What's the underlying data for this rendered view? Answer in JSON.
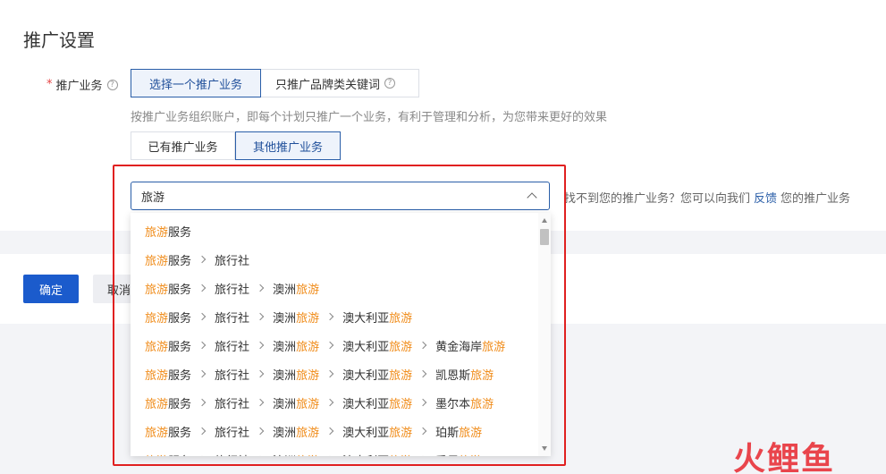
{
  "page": {
    "title": "推广设置"
  },
  "field": {
    "required_mark": "*",
    "label": "推广业务",
    "help": "?"
  },
  "mode_tabs": [
    {
      "label": "选择一个推广业务",
      "active": true
    },
    {
      "label": "只推广品牌类关键词",
      "active": false,
      "help": "?"
    }
  ],
  "hint": "按推广业务组织账户，即每个计划只推广一个业务，有利于管理和分析，为您带来更好的效果",
  "source_tabs": [
    {
      "label": "已有推广业务",
      "active": false
    },
    {
      "label": "其他推广业务",
      "active": true
    }
  ],
  "search": {
    "value": "旅游"
  },
  "not_found": {
    "prefix": "找不到您的推广业务？您可以向我们",
    "link": "反馈",
    "suffix": "您的推广业务"
  },
  "dropdown": {
    "highlight": "旅游",
    "items": [
      [
        "旅游服务"
      ],
      [
        "旅游服务",
        "旅行社"
      ],
      [
        "旅游服务",
        "旅行社",
        "澳洲旅游"
      ],
      [
        "旅游服务",
        "旅行社",
        "澳洲旅游",
        "澳大利亚旅游"
      ],
      [
        "旅游服务",
        "旅行社",
        "澳洲旅游",
        "澳大利亚旅游",
        "黄金海岸旅游"
      ],
      [
        "旅游服务",
        "旅行社",
        "澳洲旅游",
        "澳大利亚旅游",
        "凯恩斯旅游"
      ],
      [
        "旅游服务",
        "旅行社",
        "澳洲旅游",
        "澳大利亚旅游",
        "墨尔本旅游"
      ],
      [
        "旅游服务",
        "旅行社",
        "澳洲旅游",
        "澳大利亚旅游",
        "珀斯旅游"
      ],
      [
        "旅游服务",
        "旅行社",
        "澳洲旅游",
        "澳大利亚旅游",
        "悉尼旅游"
      ]
    ]
  },
  "actions": {
    "confirm": "确定",
    "cancel": "取消"
  },
  "watermark": "火鲤鱼",
  "colors": {
    "accent": "#1b5bcc",
    "highlight": "#f08c1a",
    "annotation": "#e02020"
  }
}
